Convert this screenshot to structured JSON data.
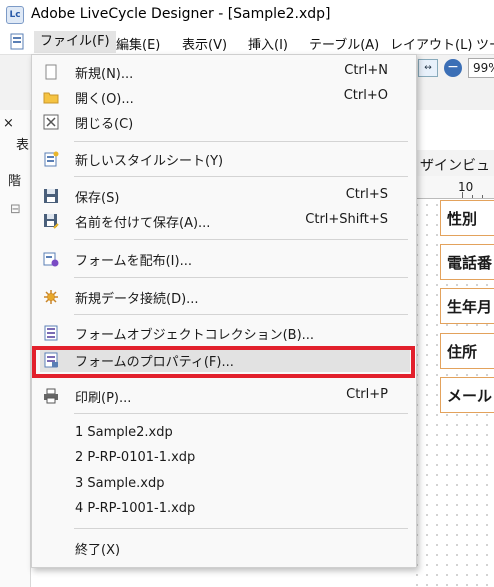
{
  "window": {
    "title": "Adobe LiveCycle Designer - [Sample2.xdp]",
    "app_icon_text": "Lc"
  },
  "menubar": {
    "items": [
      {
        "label": "ファイル(F)"
      },
      {
        "label": "編集(E)"
      },
      {
        "label": "表示(V)"
      },
      {
        "label": "挿入(I)"
      },
      {
        "label": "テーブル(A)"
      },
      {
        "label": "レイアウト(L)"
      },
      {
        "label": "ツー"
      }
    ]
  },
  "toolbar": {
    "zoom_value": "99%"
  },
  "left_panel": {
    "tab1": "表",
    "tab2": "階"
  },
  "design": {
    "tab_label": "ザインビュ",
    "ruler_label": "10",
    "fields": [
      "性別",
      "電話番",
      "生年月",
      "住所",
      "メール"
    ]
  },
  "file_menu": {
    "items": [
      {
        "label": "新規(N)...",
        "shortcut": "Ctrl+N",
        "icon": "new-document-icon"
      },
      {
        "label": "開く(O)...",
        "shortcut": "Ctrl+O",
        "icon": "open-folder-icon"
      },
      {
        "label": "閉じる(C)",
        "shortcut": "",
        "icon": "close-box-icon"
      },
      {
        "label": "新しいスタイルシート(Y)",
        "shortcut": "",
        "icon": "new-stylesheet-icon"
      },
      {
        "label": "保存(S)",
        "shortcut": "Ctrl+S",
        "icon": "save-icon"
      },
      {
        "label": "名前を付けて保存(A)...",
        "shortcut": "Ctrl+Shift+S",
        "icon": "save-as-icon"
      },
      {
        "label": "フォームを配布(I)...",
        "shortcut": "",
        "icon": "distribute-form-icon"
      },
      {
        "label": "新規データ接続(D)...",
        "shortcut": "",
        "icon": "data-connection-icon"
      },
      {
        "label": "フォームオブジェクトコレクション(B)...",
        "shortcut": "",
        "icon": "object-collection-icon"
      },
      {
        "label": "フォームのプロパティ(F)...",
        "shortcut": "",
        "icon": "form-properties-icon"
      },
      {
        "label": "印刷(P)...",
        "shortcut": "Ctrl+P",
        "icon": "printer-icon"
      },
      {
        "label": "1 Sample2.xdp",
        "shortcut": ""
      },
      {
        "label": "2 P-RP-0101-1.xdp",
        "shortcut": ""
      },
      {
        "label": "3 Sample.xdp",
        "shortcut": ""
      },
      {
        "label": "4 P-RP-1001-1.xdp",
        "shortcut": ""
      },
      {
        "label": "終了(X)",
        "shortcut": ""
      }
    ]
  },
  "colors": {
    "highlight_box": "#e2202c",
    "menu_bg": "#f9f9f9",
    "form_border": "#e3a25c"
  }
}
